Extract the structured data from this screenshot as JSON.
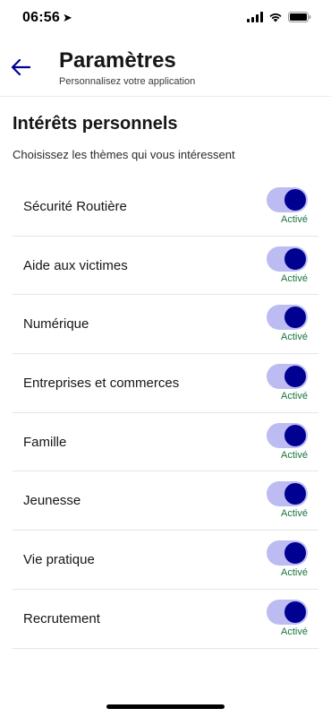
{
  "status_bar": {
    "time": "06:56",
    "location_icon": "location-arrow-icon"
  },
  "header": {
    "title": "Paramètres",
    "subtitle": "Personnalisez votre application",
    "back_icon": "arrow-left-icon"
  },
  "section": {
    "title": "Intérêts personnels",
    "description": "Choisissez les thèmes qui vous intéressent"
  },
  "interests": [
    {
      "label": "Sécurité Routière",
      "enabled": true,
      "state_label": "Activé"
    },
    {
      "label": "Aide aux victimes",
      "enabled": true,
      "state_label": "Activé"
    },
    {
      "label": "Numérique",
      "enabled": true,
      "state_label": "Activé"
    },
    {
      "label": "Entreprises et commerces",
      "enabled": true,
      "state_label": "Activé"
    },
    {
      "label": "Famille",
      "enabled": true,
      "state_label": "Activé"
    },
    {
      "label": "Jeunesse",
      "enabled": true,
      "state_label": "Activé"
    },
    {
      "label": "Vie pratique",
      "enabled": true,
      "state_label": "Activé"
    },
    {
      "label": "Recrutement",
      "enabled": true,
      "state_label": "Activé"
    }
  ],
  "colors": {
    "accent": "#000091",
    "toggle_track_on": "#bcbcf2",
    "active_text": "#18753c"
  }
}
